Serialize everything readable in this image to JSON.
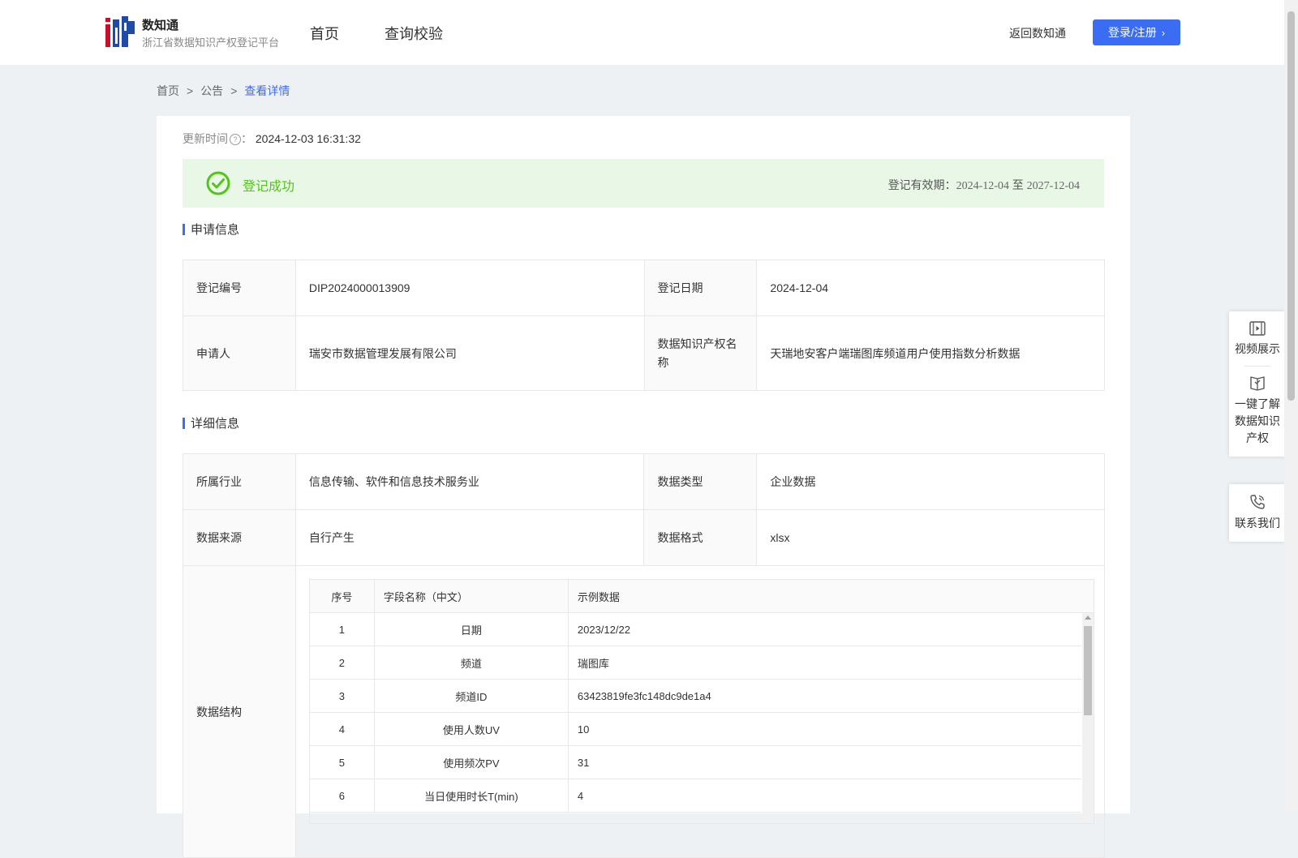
{
  "header": {
    "logo_title": "数知通",
    "logo_subtitle": "浙江省数据知识产权登记平台",
    "nav": [
      "首页",
      "查询校验"
    ],
    "back_link": "返回数知通",
    "login_label": "登录/注册"
  },
  "breadcrumb": [
    "首页",
    "公告",
    "查看详情"
  ],
  "update": {
    "label": "更新时间",
    "suffix": "：",
    "value": "2024-12-03 16:31:32"
  },
  "status": {
    "text": "登记成功",
    "valid_label": "登记有效期：",
    "valid_from": "2024-12-04",
    "valid_sep": "至",
    "valid_to": "2027-12-04",
    "color": "#52c41a"
  },
  "apply": {
    "title": "申请信息",
    "reg_no_label": "登记编号",
    "reg_no": "DIP2024000013909",
    "reg_date_label": "登记日期",
    "reg_date": "2024-12-04",
    "applicant_label": "申请人",
    "applicant": "瑞安市数据管理发展有限公司",
    "name_label": "数据知识产权名称",
    "name": "天瑞地安客户端瑞图库频道用户使用指数分析数据"
  },
  "detail": {
    "title": "详细信息",
    "industry_label": "所属行业",
    "industry": "信息传输、软件和信息技术服务业",
    "type_label": "数据类型",
    "type": "企业数据",
    "source_label": "数据来源",
    "source": "自行产生",
    "format_label": "数据格式",
    "format": "xlsx",
    "structure_label": "数据结构"
  },
  "structure": {
    "headers": [
      "序号",
      "字段名称（中文）",
      "示例数据"
    ],
    "rows": [
      [
        "1",
        "日期",
        "2023/12/22"
      ],
      [
        "2",
        "频道",
        "瑞图库"
      ],
      [
        "3",
        "频道ID",
        "63423819fe3fc148dc9de1a4"
      ],
      [
        "4",
        "使用人数UV",
        "10"
      ],
      [
        "5",
        "使用频次PV",
        "31"
      ],
      [
        "6",
        "当日使用时长T(min)",
        "4"
      ]
    ]
  },
  "float_bar": {
    "video": "视频展示",
    "learn": [
      "一键了解",
      "数据知识",
      "产权"
    ],
    "contact": "联系我们"
  },
  "colors": {
    "accent": "#3a6cf4",
    "success_bg": "#e9f8e6"
  }
}
